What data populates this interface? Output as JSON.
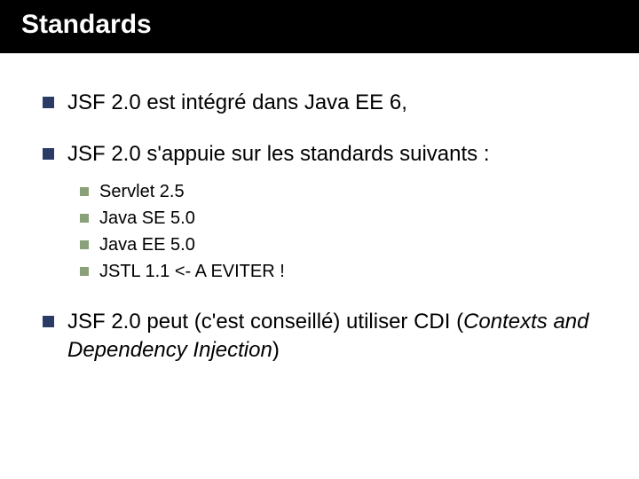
{
  "title": "Standards",
  "bullets": {
    "b0": "JSF 2.0 est intégré dans Java EE 6,",
    "b1": "JSF 2.0 s'appuie sur les standards suivants :",
    "b1_sub": {
      "s0": "Servlet 2.5",
      "s1": "Java SE 5.0",
      "s2": "Java EE 5.0",
      "s3": "JSTL 1.1 <- A EVITER !"
    },
    "b2_pre": "JSF 2.0 peut (c'est conseillé) utiliser CDI (",
    "b2_it": "Contexts and Dependency Injection",
    "b2_post": ")"
  }
}
